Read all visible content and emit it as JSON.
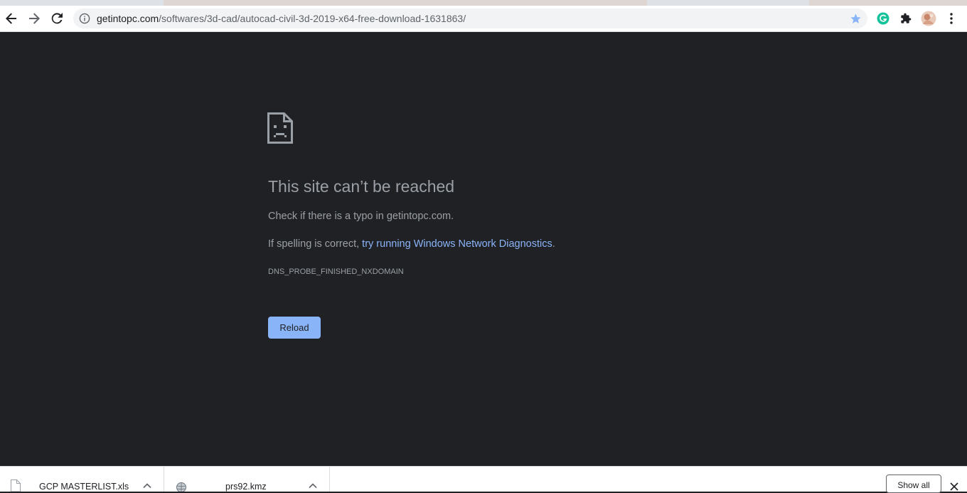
{
  "browser": {
    "url": {
      "host": "getintopc.com",
      "path": "/softwares/3d-cad/autocad-civil-3d-2019-x64-free-download-1631863/"
    },
    "icons": {
      "back": "back-arrow-icon",
      "forward": "forward-arrow-icon",
      "reload": "reload-icon",
      "site_info": "info-icon",
      "bookmark": "star-icon",
      "grammarly": "grammarly-extension-icon",
      "extensions": "puzzle-icon",
      "profile": "profile-avatar",
      "menu": "kebab-menu-icon"
    }
  },
  "error_page": {
    "title": "This site can’t be reached",
    "line1": "Check if there is a typo in getintopc.com.",
    "line2_prefix": "If spelling is correct, ",
    "line2_link": "try running Windows Network Diagnostics",
    "line2_suffix": ".",
    "error_code": "DNS_PROBE_FINISHED_NXDOMAIN",
    "reload_label": "Reload",
    "icon": "sad-page-icon"
  },
  "downloads": {
    "items": [
      {
        "name": "GCP MASTERLIST.xls",
        "icon": "document-file-icon"
      },
      {
        "name": "prs92.kmz",
        "icon": "globe-file-icon"
      }
    ],
    "show_all_label": "Show all"
  },
  "colors": {
    "page_bg": "#202124",
    "text": "#9aa0a6",
    "link": "#8ab4f8",
    "button_bg": "#8ab4f8",
    "bookmark_star": "#8ab4f8",
    "grammarly": "#15c39a"
  }
}
